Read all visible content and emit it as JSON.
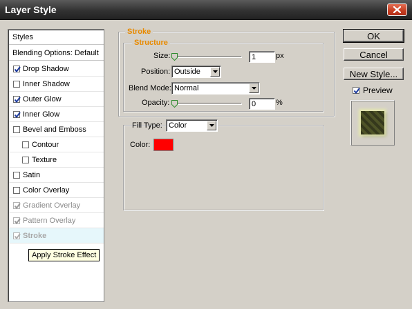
{
  "window": {
    "title": "Layer Style"
  },
  "styles_list": {
    "header": "Styles",
    "items": [
      {
        "label": "Blending Options: Default",
        "type": "header"
      },
      {
        "label": "Drop Shadow",
        "checked": true
      },
      {
        "label": "Inner Shadow",
        "checked": false
      },
      {
        "label": "Outer Glow",
        "checked": true
      },
      {
        "label": "Inner Glow",
        "checked": true
      },
      {
        "label": "Bevel and Emboss",
        "checked": false
      },
      {
        "label": "Contour",
        "checked": false,
        "indent": true
      },
      {
        "label": "Texture",
        "checked": false,
        "indent": true
      },
      {
        "label": "Satin",
        "checked": false
      },
      {
        "label": "Color Overlay",
        "checked": false
      },
      {
        "label": "Gradient Overlay",
        "checked": true,
        "disabled": true
      },
      {
        "label": "Pattern Overlay",
        "checked": true,
        "disabled": true
      },
      {
        "label": "Stroke",
        "checked": true,
        "selected": true
      }
    ]
  },
  "tooltip": "Apply Stroke Effect",
  "stroke": {
    "section_title": "Stroke",
    "structure_title": "Structure",
    "size": {
      "label": "Size:",
      "value": "1",
      "unit": "px"
    },
    "position": {
      "label": "Position:",
      "value": "Outside"
    },
    "blend_mode": {
      "label": "Blend Mode:",
      "value": "Normal"
    },
    "opacity": {
      "label": "Opacity:",
      "value": "0",
      "unit": "%"
    },
    "fill_type": {
      "label": "Fill Type:",
      "value": "Color"
    },
    "color": {
      "label": "Color:",
      "swatch": "#ff0000"
    }
  },
  "buttons": {
    "ok": "OK",
    "cancel": "Cancel",
    "new_style": "New Style..."
  },
  "preview": {
    "label": "Preview",
    "checked": true
  },
  "colors": {
    "accent_orange": "#e88a00",
    "selected_row": "#e6f7fb",
    "dialog_bg": "#d4d0c8"
  }
}
